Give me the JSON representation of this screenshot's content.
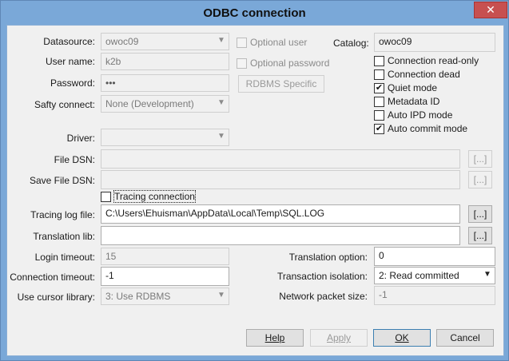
{
  "window": {
    "title": "ODBC connection",
    "close_glyph": "✕"
  },
  "left": {
    "datasource_label": "Datasource:",
    "datasource_value": "owoc09",
    "username_label": "User name:",
    "username_value": "k2b",
    "password_label": "Password:",
    "password_value": "•••",
    "safty_label": "Safty connect:",
    "safty_value": "None (Development)"
  },
  "middle": {
    "optional_user": "Optional user",
    "optional_password": "Optional password",
    "rdbms_button": "RDBMS Specific"
  },
  "right": {
    "catalog_label": "Catalog:",
    "catalog_value": "owoc09",
    "options": [
      {
        "label": "Connection read-only",
        "checked": false
      },
      {
        "label": "Connection dead",
        "checked": false
      },
      {
        "label": "Quiet mode",
        "checked": true
      },
      {
        "label": "Metadata ID",
        "checked": false
      },
      {
        "label": "Auto IPD mode",
        "checked": false
      },
      {
        "label": "Auto commit mode",
        "checked": true
      }
    ]
  },
  "driver": {
    "driver_label": "Driver:",
    "driver_value": "",
    "filedsn_label": "File DSN:",
    "filedsn_value": "",
    "savefiledsn_label": "Save File DSN:",
    "savefiledsn_value": "",
    "browse": "[...]"
  },
  "tracing": {
    "checkbox_label": "Tracing connection",
    "checked": false,
    "logfile_label": "Tracing log file:",
    "logfile_value": "C:\\Users\\Ehuisman\\AppData\\Local\\Temp\\SQL.LOG",
    "translation_label": "Translation lib:",
    "translation_value": "",
    "browse": "[...]"
  },
  "bottom": {
    "login_timeout_label": "Login timeout:",
    "login_timeout_value": "15",
    "connection_timeout_label": "Connection timeout:",
    "connection_timeout_value": "-1",
    "cursor_label": "Use cursor library:",
    "cursor_value": "3: Use RDBMS",
    "translation_option_label": "Translation option:",
    "translation_option_value": "0",
    "isolation_label": "Transaction isolation:",
    "isolation_value": "2: Read committed",
    "packet_label": "Network packet size:",
    "packet_value": "-1"
  },
  "buttons": {
    "help": "Help",
    "apply": "Apply",
    "ok": "OK",
    "cancel": "Cancel"
  }
}
